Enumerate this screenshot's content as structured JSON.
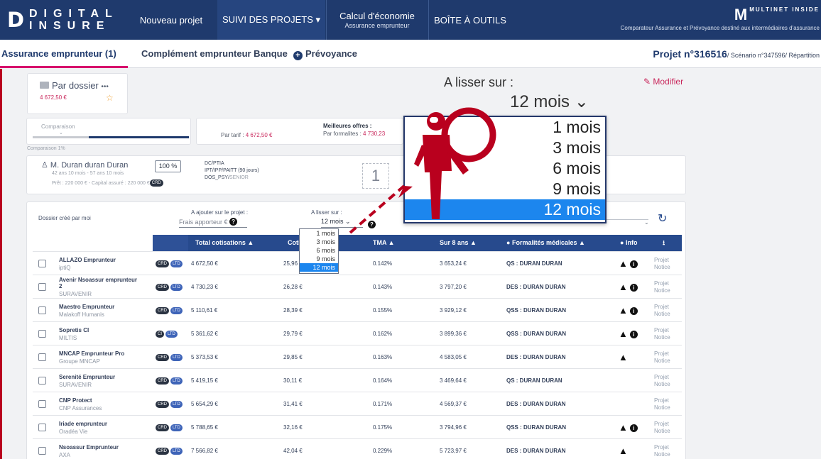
{
  "topbar": {
    "logo_mark": "D",
    "logo_line1": "DIGITAL",
    "logo_line2": "INSURE",
    "nav": [
      {
        "label": "Nouveau projet",
        "sub": ""
      },
      {
        "label": "SUIVI DES PROJETS ▾",
        "sub": ""
      },
      {
        "label": "Calcul d'économie",
        "sub": "Assurance emprunteur"
      },
      {
        "label": "BOÎTE À OUTILS",
        "sub": ""
      }
    ],
    "multi_logo": "M",
    "multi_small": "MULTINET INSIDE",
    "multi_tag": "Comparateur Assurance et Prévoyance destiné aux intermédiaires d'assurance"
  },
  "tabs": {
    "items": [
      "Assurance emprunteur (1)",
      "Complément emprunteur Banque",
      "Prévoyance"
    ],
    "projet": "Projet n°316516",
    "projet_suffix": "/ Scénario n°347596/ Répartition"
  },
  "dossier": {
    "title": "Par dossier",
    "more": "•••",
    "amount": "4 672,50 €",
    "comparison_label": "Comparaison",
    "comparison_percent": "Comparaison",
    "comparison_percent_value": "1%",
    "par_tarif_label": "Par tarif :",
    "par_tarif_value": "4 672,50 €",
    "best_offers": "Meilleures offres :",
    "par_formalites_label": "Par formalites :",
    "par_formalites_value": "4 730,23"
  },
  "borrower": {
    "name": "M. Duran duran Duran",
    "percent": "100 %",
    "line1": "42 ans 10 mois - 57 ans 10 mois",
    "line2": "Prêt : 220 000 € - Capital assuré : 220 000 €",
    "guarantees": [
      "DC/PTIA",
      "IPT/IPP/",
      "PAITT (90 jours)",
      "DOS_PSY/",
      "SENIOR"
    ],
    "counter": "1"
  },
  "controls": {
    "dossier_cree": "Dossier créé par moi",
    "ajouter_label": "A ajouter sur le projet :",
    "frais_apporteur": "Frais apporteur",
    "euro": "€",
    "lisser_label": "A lisser sur :",
    "lisser_value": "12 mois",
    "modifier": "Modifier",
    "big_lisser_label": "A lisser sur :",
    "big_lisser_value": "12 mois",
    "big_options": [
      "1 mois",
      "3 mois",
      "6 mois",
      "9 mois",
      "12 mois"
    ],
    "small_options": [
      "1 mois",
      "3 mois",
      "6 mois",
      "9 mois",
      "12 mois"
    ]
  },
  "table": {
    "headers": [
      "Total cotisations ▲",
      "Coti",
      "TMA ▲",
      "Sur 8 ans ▲",
      "Formalités médicales ▲",
      "Info",
      ""
    ],
    "rows": [
      {
        "name": "ALLAZO Emprunteur",
        "insurer": "iptiQ",
        "total": "4 672,50 €",
        "coti": "25,96 €",
        "tma": "0.142%",
        "sur8": "3 653,24 €",
        "formalites": "QS : DURAN DURAN",
        "warn": true,
        "info": true
      },
      {
        "name": "Avenir Nsoassur emprunteur",
        "name2": "2",
        "insurer": "SURAVENIR",
        "total": "4 730,23 €",
        "coti": "26,28 €",
        "tma": "0.143%",
        "sur8": "3 797,20 €",
        "formalites": "DES : DURAN DURAN",
        "warn": true,
        "info": true
      },
      {
        "name": "Maestro Emprunteur",
        "insurer": "Malakoff Humanis",
        "total": "5 110,61 €",
        "coti": "28,39 €",
        "tma": "0.155%",
        "sur8": "3 929,12 €",
        "formalites": "QSS : DURAN DURAN",
        "warn": true,
        "info": true
      },
      {
        "name": "Sopretis CI",
        "insurer": "MILTIS",
        "total": "5 361,62 €",
        "coti": "29,79 €",
        "tma": "0.162%",
        "sur8": "3 899,36 €",
        "formalites": "QSS : DURAN DURAN",
        "warn": true,
        "info": true
      },
      {
        "name": "MNCAP Emprunteur Pro",
        "insurer": "Groupe MNCAP",
        "total": "5 373,53 €",
        "coti": "29,85 €",
        "tma": "0.163%",
        "sur8": "4 583,05 €",
        "formalites": "DES : DURAN DURAN",
        "warn": true,
        "info": false
      },
      {
        "name": "Serenité Emprunteur",
        "insurer": "SURAVENIR",
        "total": "5 419,15 €",
        "coti": "30,11 €",
        "tma": "0.164%",
        "sur8": "3 469,64 €",
        "formalites": "QS : DURAN DURAN",
        "warn": false,
        "info": false
      },
      {
        "name": "CNP Protect",
        "insurer": "CNP Assurances",
        "total": "5 654,29 €",
        "coti": "31,41 €",
        "tma": "0.171%",
        "sur8": "4 569,37 €",
        "formalites": "DES : DURAN DURAN",
        "warn": false,
        "info": false
      },
      {
        "name": "Iriade emprunteur",
        "insurer": "Oradéa Vie",
        "total": "5 788,65 €",
        "coti": "32,16 €",
        "tma": "0.175%",
        "sur8": "3 794,96 €",
        "formalites": "QSS : DURAN DURAN",
        "warn": true,
        "info": true
      },
      {
        "name": "Nsoassur Emprunteur",
        "insurer": "AXA",
        "total": "7 566,82 €",
        "coti": "42,04 €",
        "tma": "0.229%",
        "sur8": "5 723,97 €",
        "formalites": "DES : DURAN DURAN",
        "warn": true,
        "info": false
      }
    ],
    "badge1": "CRD",
    "badge2": "LTD",
    "badge_alt": "CI",
    "link1": "Projet",
    "link2": "Notice"
  },
  "colors": {
    "navy": "#1f3a6d",
    "table_header": "#274a8d",
    "accent": "#d7006c",
    "selected": "#1c86ee",
    "magnifier": "#b9001e"
  }
}
